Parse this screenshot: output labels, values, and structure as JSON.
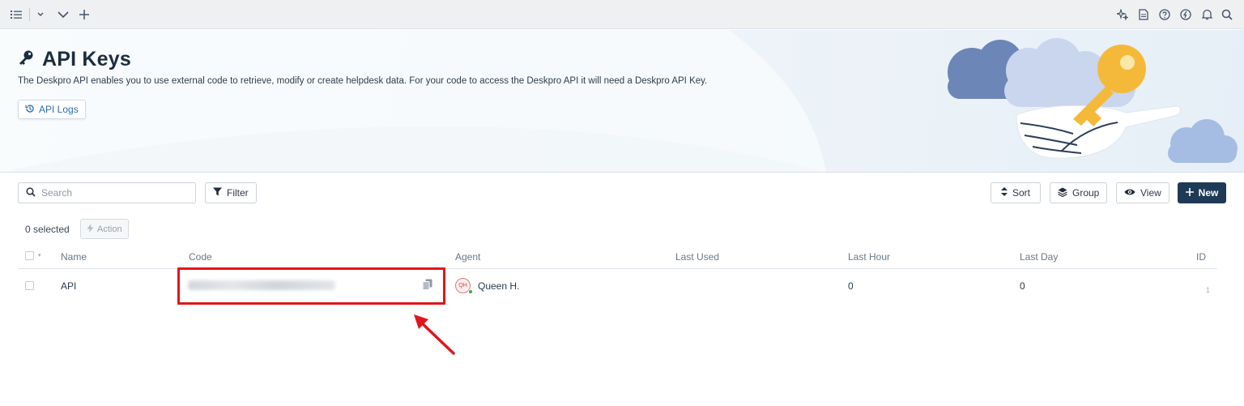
{
  "header": {
    "title": "API Keys",
    "description": "The Deskpro API enables you to use external code to retrieve, modify or create helpdesk data. For your code to access the Deskpro API it will need a Deskpro API Key.",
    "api_logs_label": "API Logs"
  },
  "toolbar": {
    "search_placeholder": "Search",
    "filter_label": "Filter",
    "sort_label": "Sort",
    "group_label": "Group",
    "view_label": "View",
    "new_label": "New"
  },
  "selection": {
    "count_label": "0 selected",
    "action_label": "Action"
  },
  "table": {
    "columns": [
      "Name",
      "Code",
      "Agent",
      "Last Used",
      "Last Hour",
      "Last Day",
      "ID"
    ],
    "rows": [
      {
        "name": "API",
        "agent_initials": "QH",
        "agent_name": "Queen H.",
        "last_used": "",
        "last_hour": "0",
        "last_day": "0",
        "id": "1"
      }
    ]
  },
  "colors": {
    "accent": "#1e3a56",
    "highlight": "#e0161b",
    "link": "#2b6cb0"
  },
  "icons": {
    "topbar_left": [
      "list-icon",
      "chevron-down-icon",
      "chevron-down-icon",
      "plus-icon"
    ],
    "topbar_right": [
      "sparkle-icon",
      "document-icon",
      "help-icon",
      "whatsnew-icon",
      "bell-icon",
      "search-icon"
    ]
  }
}
